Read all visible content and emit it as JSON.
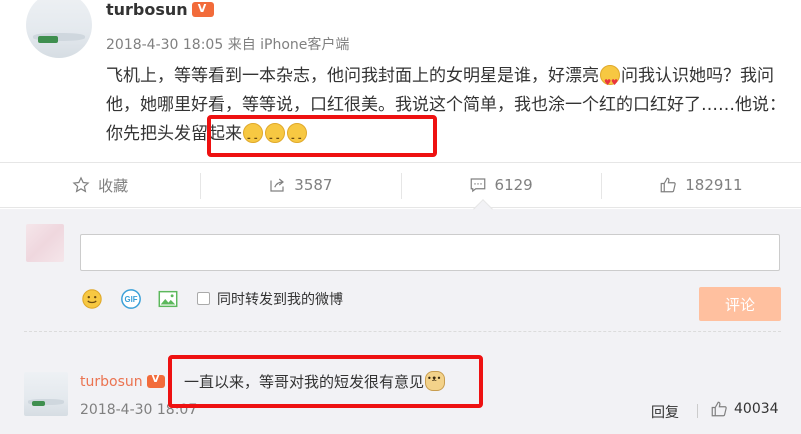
{
  "post": {
    "username": "turbosun",
    "time": "2018-4-30 18:05",
    "source": "来自 iPhone客户端",
    "text_parts": [
      "飞机上，等等看到一本杂志，他问我封面上的女明星是谁，好漂亮",
      "问我认识她吗？我问他，她哪里好看，等等说，口红很美。我说这个简单，我也涂一个红的口红好了……",
      "他说：你先把头发留起来"
    ]
  },
  "actions": {
    "favorite_label": "收藏",
    "repost_count": "3587",
    "comment_count": "6129",
    "like_count": "182911"
  },
  "compose": {
    "input_value": "",
    "repost_label": "同时转发到我的微博",
    "submit_label": "评论"
  },
  "comment": {
    "username": "turbosun",
    "text": "一直以来，等哥对我的短发很有意见",
    "time": "2018-4-30 18:07",
    "reply_label": "回复",
    "like_count": "40034"
  },
  "colors": {
    "highlight_box": "#ee1111",
    "username_link": "#eb7350",
    "submit_bg": "#ffc09f"
  }
}
